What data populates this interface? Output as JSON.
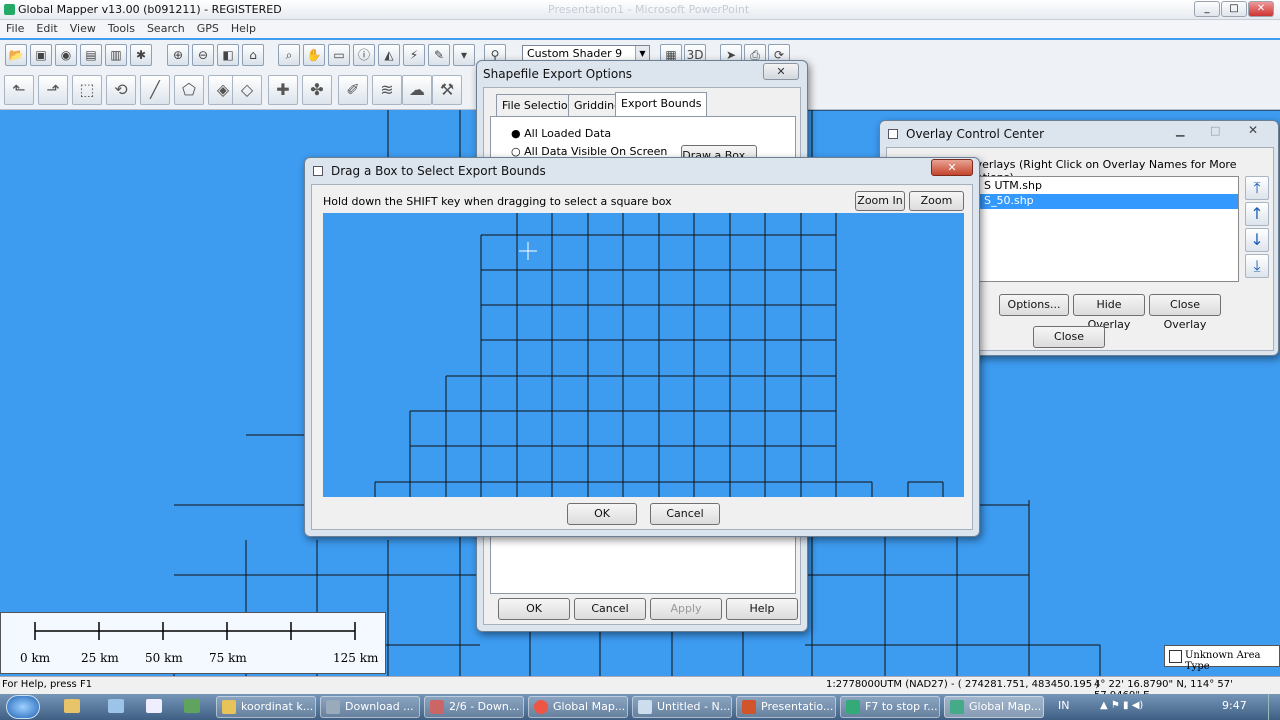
{
  "app": {
    "title": "Global Mapper v13.00 (b091211) - REGISTERED",
    "ghost_title": "Presentation1 - Microsoft PowerPoint",
    "window_controls": [
      "minimize",
      "maximize",
      "close"
    ]
  },
  "menu": [
    "File",
    "Edit",
    "View",
    "Tools",
    "Search",
    "GPS",
    "Help"
  ],
  "toolbar": {
    "shader_value": "Custom Shader 9"
  },
  "shapefile_dialog": {
    "title": "Shapefile Export Options",
    "tabs": [
      "File Selection",
      "Gridding",
      "Export Bounds"
    ],
    "active_tab": "Export Bounds",
    "options": [
      "All Loaded Data",
      "All Data Visible On Screen"
    ],
    "draw_box_label": "Draw a Box...",
    "buttons": {
      "ok": "OK",
      "cancel": "Cancel",
      "apply": "Apply",
      "help": "Help"
    }
  },
  "drag_dialog": {
    "title": "Drag a Box to Select Export Bounds",
    "hint": "Hold down the SHIFT key when dragging to select a square box",
    "zoom_in": "Zoom In",
    "zoom_out": "Zoom Out",
    "ok": "OK",
    "cancel": "Cancel"
  },
  "overlay_dialog": {
    "title": "Overlay Control Center",
    "header": "Overlays (Right Click on Overlay Names for More Options)",
    "items": [
      "S UTM.shp",
      "S_50.shp"
    ],
    "selected_index": 1,
    "buttons": {
      "options": "Options...",
      "hide": "Hide Overlay",
      "close_overlay": "Close Overlay",
      "close": "Close"
    }
  },
  "scale_bar": {
    "labels": [
      "0 km",
      "25 km",
      "50 km",
      "75 km",
      "125 km"
    ]
  },
  "legend": {
    "unknown_area": "Unknown Area Type"
  },
  "status": {
    "help": "For Help, press F1",
    "scale": "1:2778000",
    "projection": "UTM (NAD27) - ( 274281.751, 483450.195 )",
    "latlon": "4° 22' 16.8790\" N, 114° 57' 57.9469\" E"
  },
  "taskbar": {
    "tasks": [
      "koordinat k...",
      "Download ...",
      "2/6 - Down...",
      "Global Map...",
      "Untitled - N...",
      "Presentatio...",
      "F7 to stop r...",
      "Global Map..."
    ],
    "lang": "IN",
    "time": "9:47"
  },
  "colors": {
    "map": "#3d9bf0",
    "selection": "#3399ff",
    "dialog": "#f0f0f0"
  }
}
